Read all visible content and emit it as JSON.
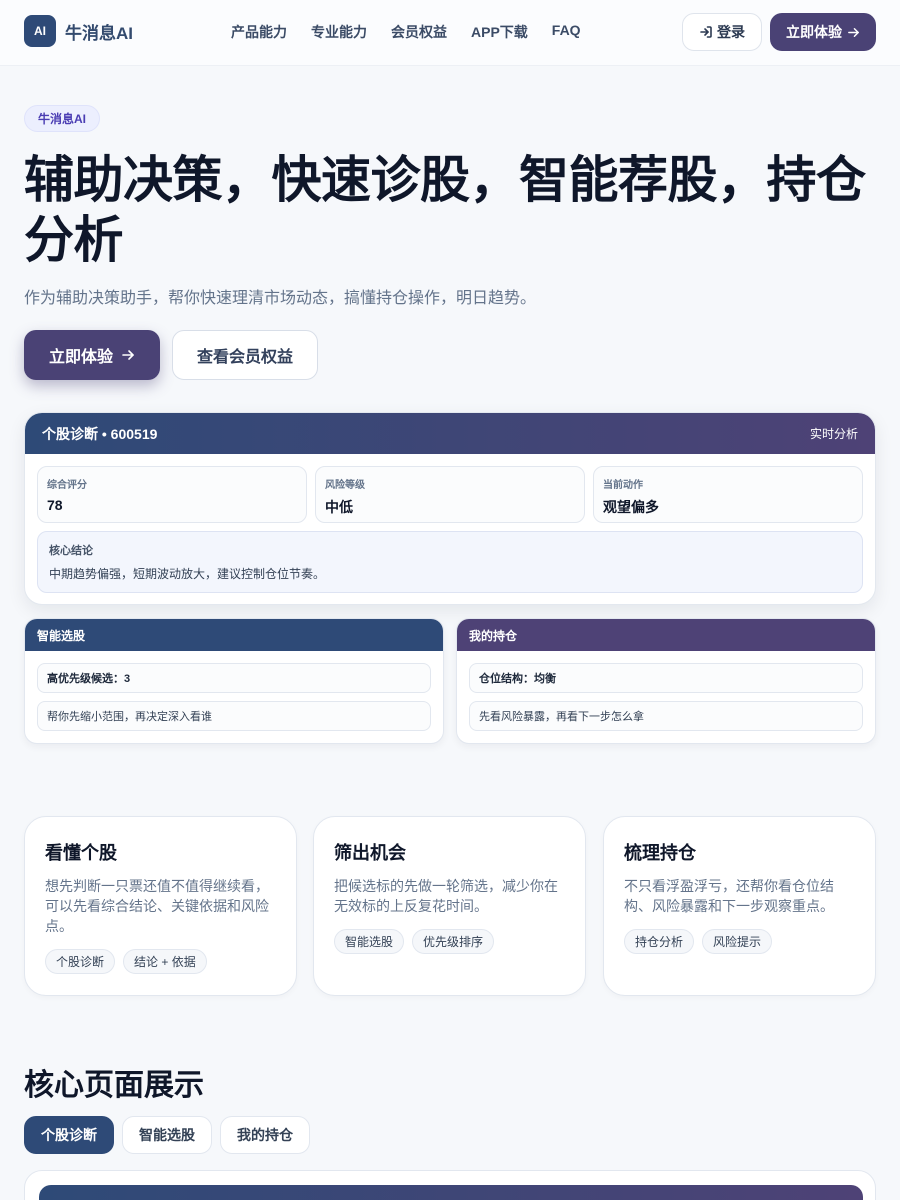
{
  "header": {
    "logo_badge": "AI",
    "brand": "牛消息AI",
    "nav": [
      "产品能力",
      "专业能力",
      "会员权益",
      "APP下载",
      "FAQ"
    ],
    "login_label": "登录",
    "try_label": "立即体验"
  },
  "hero": {
    "tag": "牛消息AI",
    "title": "辅助决策，快速诊股，智能荐股，持仓分析",
    "subtitle": "作为辅助决策助手，帮你快速理清市场动态，搞懂持仓操作，明日趋势。",
    "primary_button": "立即体验",
    "secondary_button": "查看会员权益"
  },
  "diagnosis": {
    "title": "个股诊断 • 600519",
    "live_label": "实时分析",
    "metrics": [
      {
        "label": "综合评分",
        "value": "78"
      },
      {
        "label": "风险等级",
        "value": "中低"
      },
      {
        "label": "当前动作",
        "value": "观望偏多"
      }
    ],
    "conclusion_label": "核心结论",
    "conclusion_text": "中期趋势偏强，短期波动放大，建议控制仓位节奏。"
  },
  "mini_cards": [
    {
      "title": "智能选股",
      "row1": "高优先级候选：3",
      "row2": "帮你先缩小范围，再决定深入看谁",
      "color": "#2e4a77"
    },
    {
      "title": "我的持仓",
      "row1": "仓位结构：均衡",
      "row2": "先看风险暴露，再看下一步怎么拿",
      "color": "#4e4276"
    }
  ],
  "features": [
    {
      "title": "看懂个股",
      "desc": "想先判断一只票还值不值得继续看，可以先看综合结论、关键依据和风险点。",
      "chips": [
        "个股诊断",
        "结论 + 依据"
      ]
    },
    {
      "title": "筛出机会",
      "desc": "把候选标的先做一轮筛选，减少你在无效标的上反复花时间。",
      "chips": [
        "智能选股",
        "优先级排序"
      ]
    },
    {
      "title": "梳理持仓",
      "desc": "不只看浮盈浮亏，还帮你看仓位结构、风险暴露和下一步观察重点。",
      "chips": [
        "持仓分析",
        "风险提示"
      ]
    }
  ],
  "core_section": {
    "title": "核心页面展示",
    "tabs": [
      "个股诊断",
      "智能选股",
      "我的持仓"
    ],
    "active_tab": 0
  },
  "colors": {
    "primary_navy": "#2e4a77",
    "primary_purple": "#4a4275",
    "background": "#f6f8fb"
  },
  "icons": {
    "login": "login-arrow-icon",
    "arrow": "arrow-right-icon"
  }
}
